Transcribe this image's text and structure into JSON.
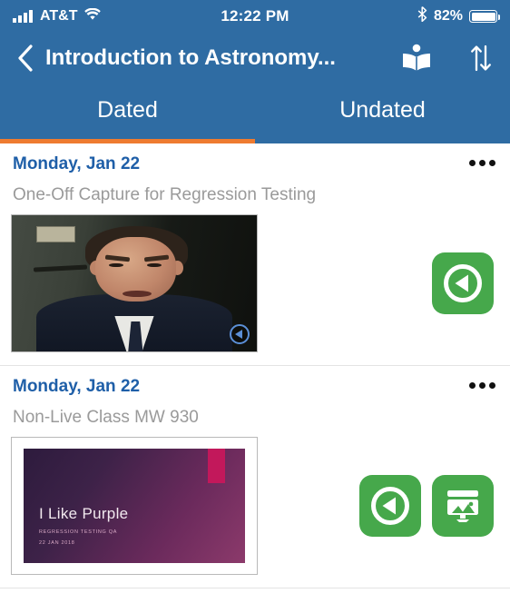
{
  "status_bar": {
    "carrier": "AT&T",
    "time": "12:22 PM",
    "battery_percent": "82%",
    "signal_icon": "signal-bars-icon",
    "wifi_icon": "wifi-icon",
    "bluetooth_icon": "bluetooth-icon",
    "battery_icon": "battery-icon"
  },
  "navbar": {
    "back_icon": "back-chevron-icon",
    "title": "Introduction to Astronomy...",
    "book_icon": "open-book-icon",
    "sort_icon": "sort-arrows-icon"
  },
  "tabs": {
    "items": [
      {
        "label": "Dated",
        "active": true
      },
      {
        "label": "Undated",
        "active": false
      }
    ],
    "indicator_color": "#EE7B30"
  },
  "colors": {
    "header_blue": "#2F6CA3",
    "accent_orange": "#EE7B30",
    "date_blue": "#1F5FA8",
    "subtitle_gray": "#9A9A9A",
    "action_green": "#46A84B"
  },
  "list": {
    "items": [
      {
        "date": "Monday, Jan 22",
        "subtitle": "One-Off Capture for Regression Testing",
        "more_icon": "more-options-icon",
        "thumbnail_type": "video",
        "thumbnail_badge_icon": "play-badge-icon",
        "actions": [
          {
            "icon": "play-circle-icon",
            "name": "play-recording-button"
          }
        ]
      },
      {
        "date": "Monday, Jan 22",
        "subtitle": "Non-Live Class MW 930",
        "more_icon": "more-options-icon",
        "thumbnail_type": "slide",
        "slide": {
          "title": "I Like Purple",
          "subtitle": "REGRESSION TESTING QA",
          "date": "22 JAN 2018"
        },
        "actions": [
          {
            "icon": "play-circle-icon",
            "name": "play-recording-button"
          },
          {
            "icon": "presentation-icon",
            "name": "view-slides-button"
          }
        ]
      }
    ]
  }
}
